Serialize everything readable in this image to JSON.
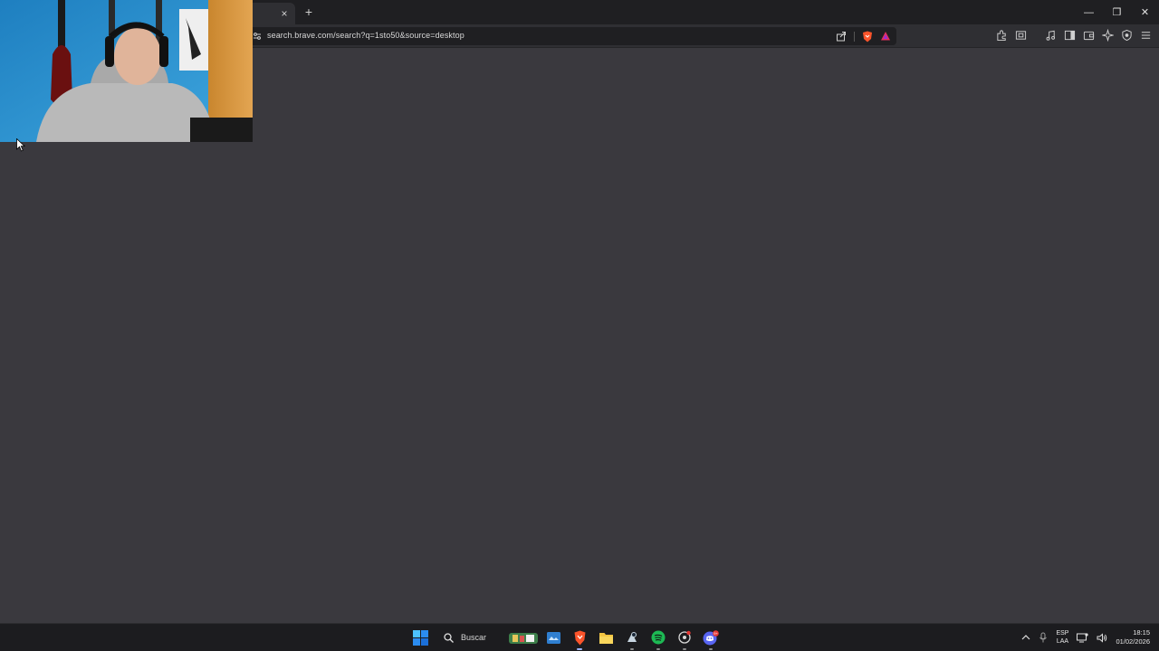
{
  "browser": {
    "tab": {
      "close_glyph": "×"
    },
    "new_tab_glyph": "+",
    "window_controls": {
      "minimize": "—",
      "maximize": "❐",
      "close": "✕"
    },
    "url": "search.brave.com/search?q=1sto50&source=desktop",
    "toolbar_icons": [
      "share-icon",
      "brave-shields-icon",
      "brave-rewards-icon",
      "extensions-icon",
      "screenshot-icon",
      "media-icon",
      "sidebar-icon",
      "wallet-icon",
      "leo-ai-icon",
      "vpn-icon",
      "menu-icon"
    ]
  },
  "content": {
    "background": "#3a393e"
  },
  "taskbar": {
    "search_label": "Buscar",
    "apps": [
      "windows-start-icon",
      "app-store-icon",
      "brave-browser-icon",
      "file-explorer-icon",
      "steam-icon",
      "spotify-icon",
      "hub-icon",
      "discord-icon"
    ],
    "discord_badge": "9+",
    "language_top": "ESP",
    "language_bottom": "LAA",
    "time": "18:15",
    "date": "01/02/2026"
  },
  "colors": {
    "accent_brave": "#fb542b",
    "spotify": "#1db954",
    "discord": "#5865f2",
    "windows": "#2b8cf0"
  }
}
